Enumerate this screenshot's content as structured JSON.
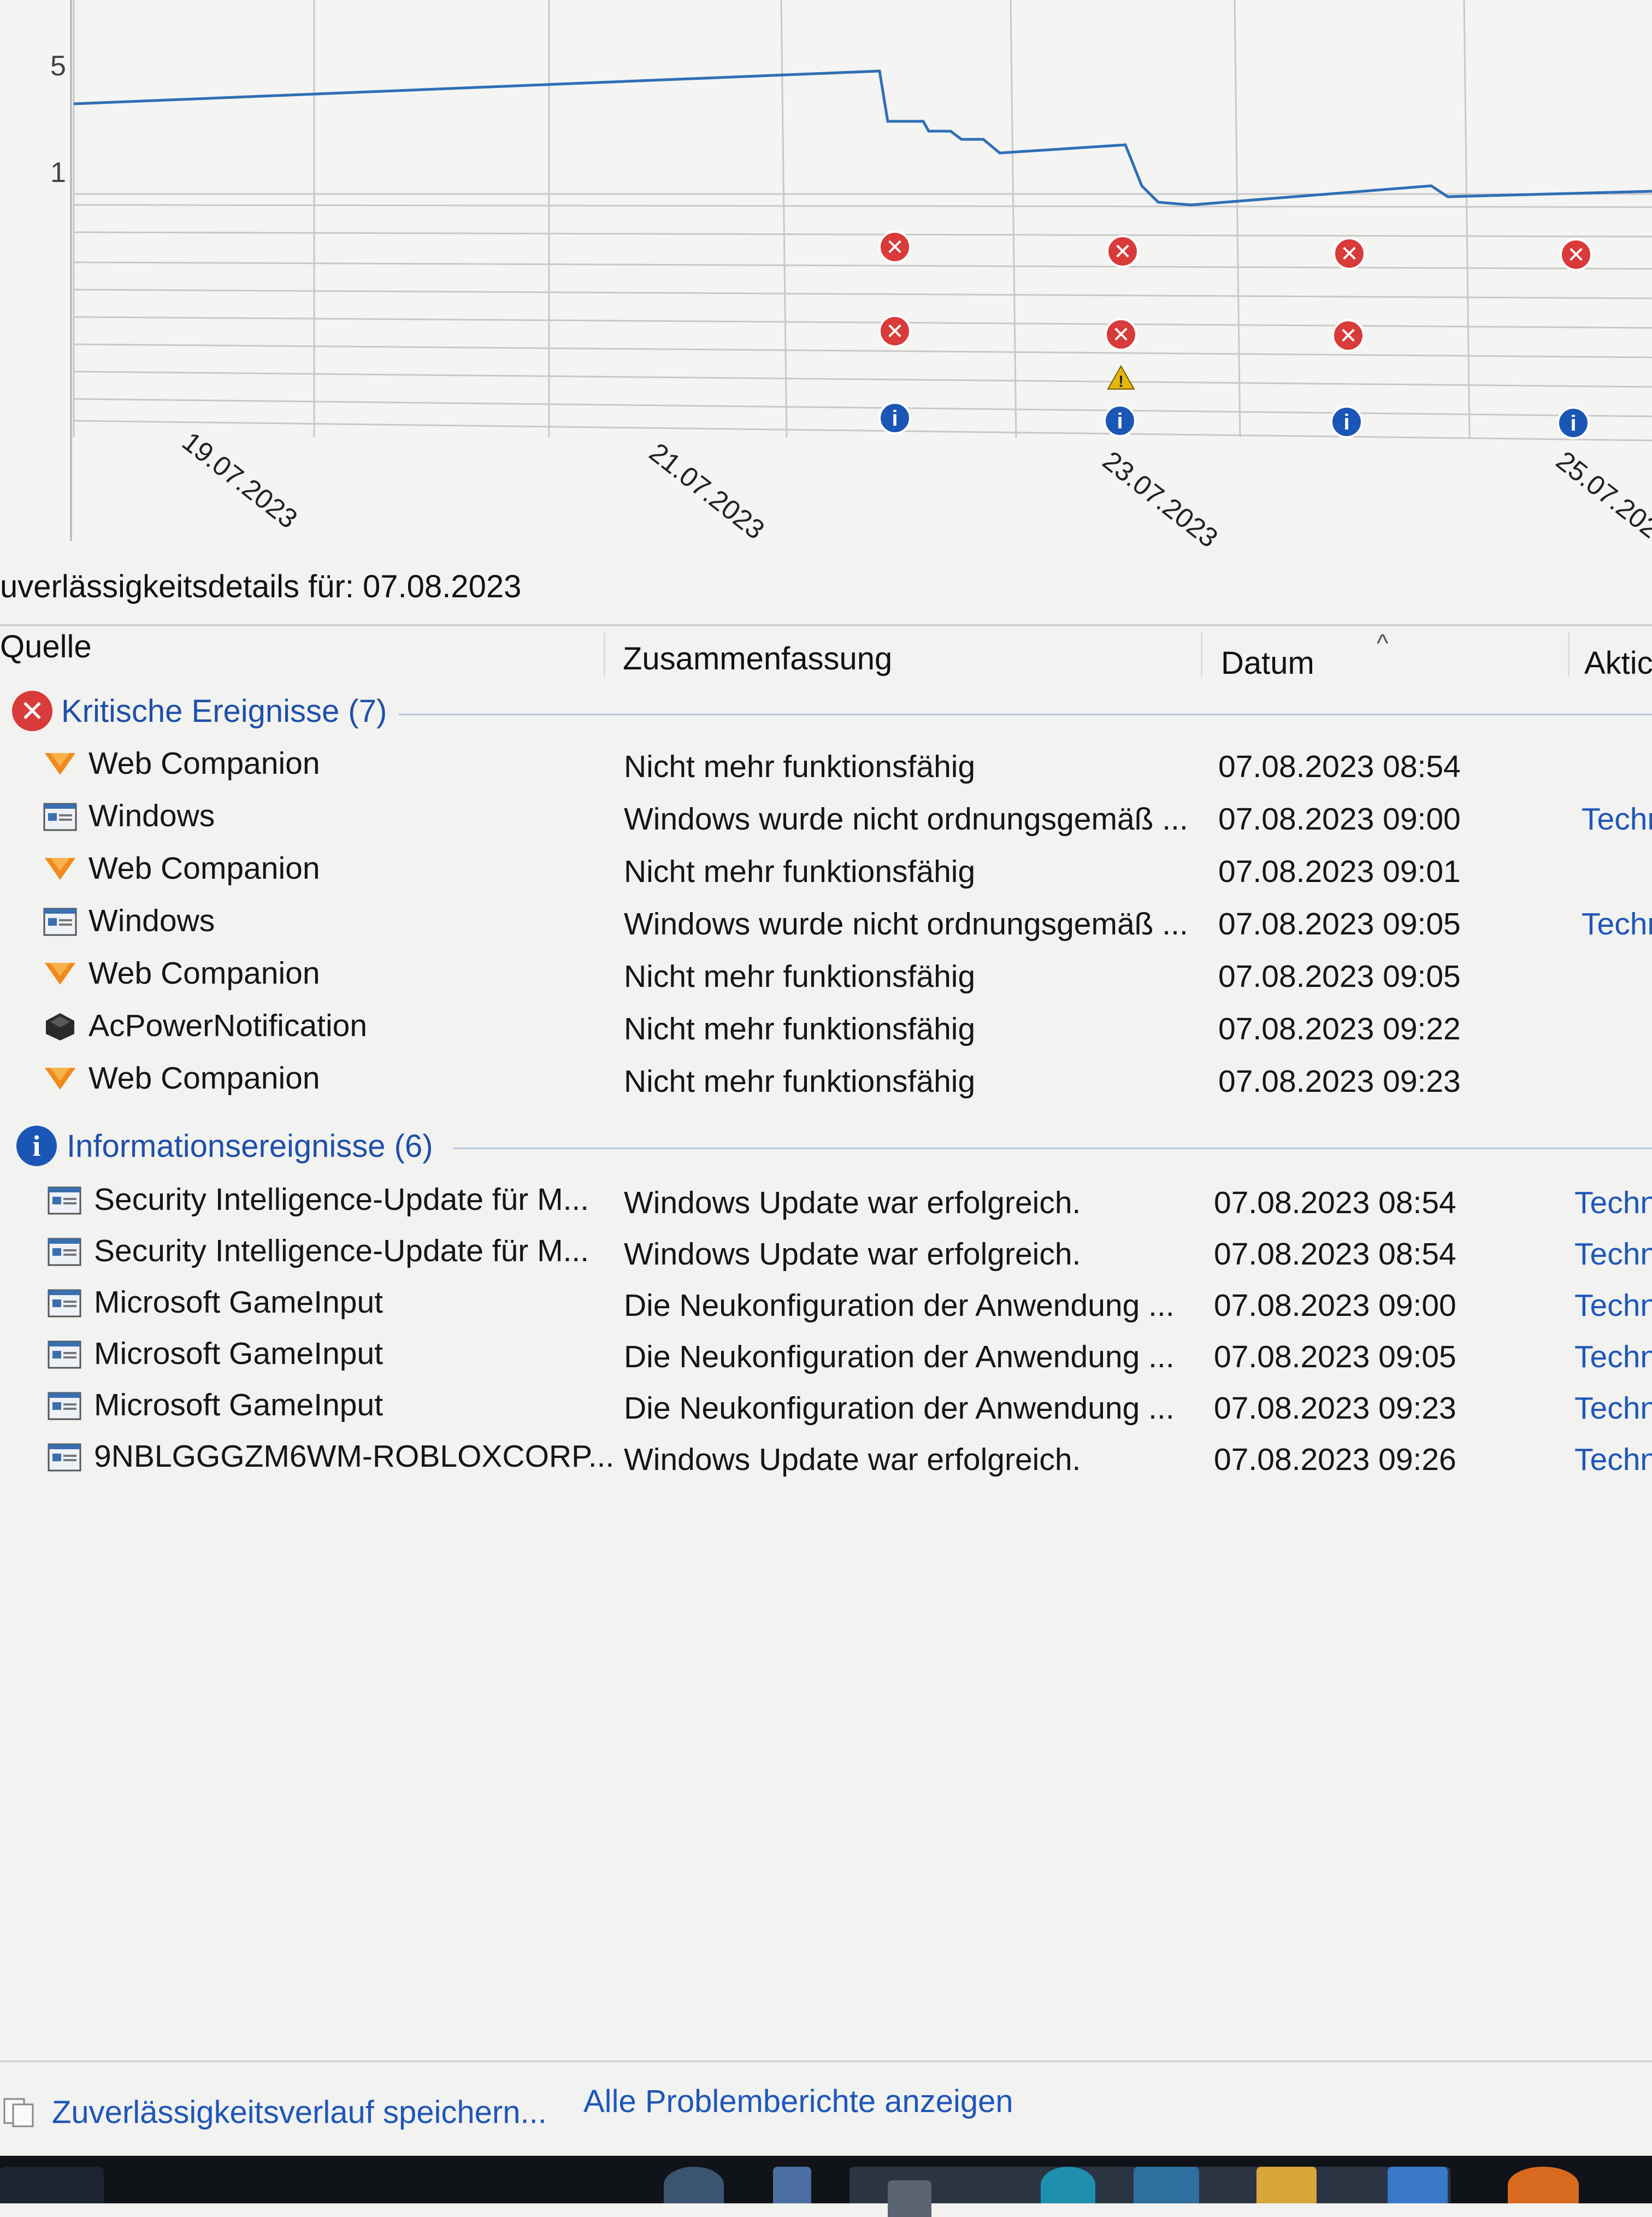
{
  "chart": {
    "y_ticks": [
      "5",
      "1"
    ],
    "x_ticks": [
      "19.07.2023",
      "21.07.2023",
      "23.07.2023",
      "25.07.202"
    ]
  },
  "chart_data": {
    "type": "line",
    "y_ticks": [
      5,
      1
    ],
    "x_labels": [
      "19.07.2023",
      "21.07.2023",
      "23.07.2023",
      "25.07.202"
    ]
  },
  "details": {
    "title": "uverlässigkeitsdetails für: 07.08.2023"
  },
  "columns": {
    "source": "Quelle",
    "summary": "Zusammenfassung",
    "date": "Datum",
    "action": "Aktic"
  },
  "groups": {
    "critical": {
      "label": "Kritische Ereignisse (7)",
      "icon_color": "#d93a3a",
      "rows": [
        {
          "source": "Web Companion",
          "summary": "Nicht mehr funktionsfähig",
          "date": "07.08.2023 08:54",
          "action": "",
          "icon": "webcompanion-icon"
        },
        {
          "source": "Windows",
          "summary": "Windows wurde nicht ordnungsgemäß ...",
          "date": "07.08.2023 09:00",
          "action": "Techr",
          "icon": "window-icon"
        },
        {
          "source": "Web Companion",
          "summary": "Nicht mehr funktionsfähig",
          "date": "07.08.2023 09:01",
          "action": "",
          "icon": "webcompanion-icon"
        },
        {
          "source": "Windows",
          "summary": "Windows wurde nicht ordnungsgemäß ...",
          "date": "07.08.2023 09:05",
          "action": "Techr",
          "icon": "window-icon"
        },
        {
          "source": "Web Companion",
          "summary": "Nicht mehr funktionsfähig",
          "date": "07.08.2023 09:05",
          "action": "",
          "icon": "webcompanion-icon"
        },
        {
          "source": "AcPowerNotification",
          "summary": "Nicht mehr funktionsfähig",
          "date": "07.08.2023 09:22",
          "action": "",
          "icon": "hexagon-icon"
        },
        {
          "source": "Web Companion",
          "summary": "Nicht mehr funktionsfähig",
          "date": "07.08.2023 09:23",
          "action": "",
          "icon": "webcompanion-icon"
        }
      ]
    },
    "info": {
      "label": "Informationsereignisse (6)",
      "icon_color": "#1a56b5",
      "rows": [
        {
          "source": "Security Intelligence-Update für M...",
          "summary": "Windows Update war erfolgreich.",
          "date": "07.08.2023 08:54",
          "action": "Techn",
          "icon": "window-icon"
        },
        {
          "source": "Security Intelligence-Update für M...",
          "summary": "Windows Update war erfolgreich.",
          "date": "07.08.2023 08:54",
          "action": "Techn",
          "icon": "window-icon"
        },
        {
          "source": "Microsoft GameInput",
          "summary": "Die Neukonfiguration der Anwendung ...",
          "date": "07.08.2023 09:00",
          "action": "Techn",
          "icon": "window-icon"
        },
        {
          "source": "Microsoft GameInput",
          "summary": "Die Neukonfiguration der Anwendung ...",
          "date": "07.08.2023 09:05",
          "action": "Techn",
          "icon": "window-icon"
        },
        {
          "source": "Microsoft GameInput",
          "summary": "Die Neukonfiguration der Anwendung ...",
          "date": "07.08.2023 09:23",
          "action": "Techn",
          "icon": "window-icon"
        },
        {
          "source": "9NBLGGGZM6WM-ROBLOXCORP...",
          "summary": "Windows Update war erfolgreich.",
          "date": "07.08.2023 09:26",
          "action": "Techn",
          "icon": "window-icon"
        }
      ]
    }
  },
  "bottom": {
    "save_label": "Zuverlässigkeitsverlauf speichern...",
    "reports_label": "Alle Problemberichte anzeigen"
  },
  "colors": {
    "link": "#1f56b8",
    "chart_line": "#2f6fb5",
    "critical": "#d93a3a",
    "info": "#1a56b5",
    "warning": "#e5b70e"
  }
}
